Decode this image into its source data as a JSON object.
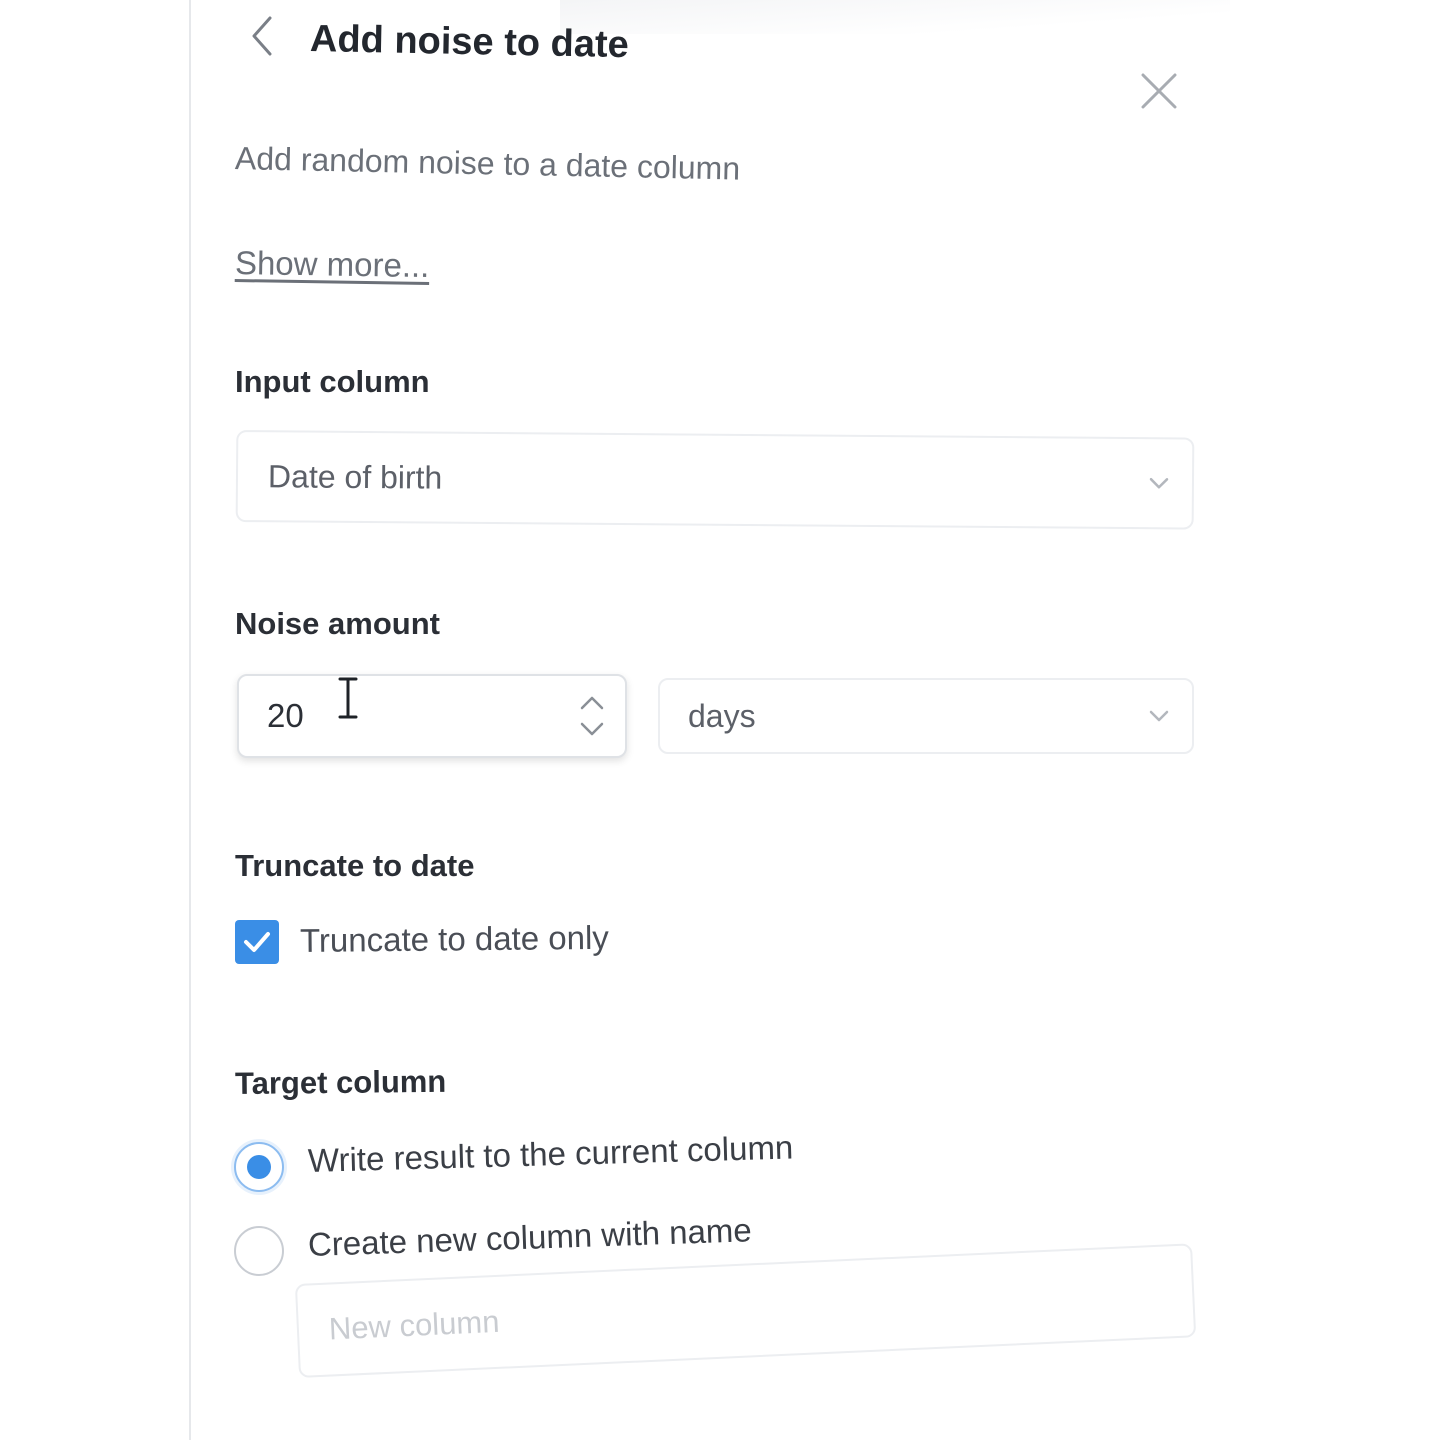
{
  "header": {
    "title": "Add noise to date",
    "subtitle": "Add random noise to a date column",
    "show_more": "Show more..."
  },
  "input_column": {
    "label": "Input column",
    "value": "Date of birth"
  },
  "noise_amount": {
    "label": "Noise amount",
    "value": "20",
    "unit": "days"
  },
  "truncate": {
    "label": "Truncate to date",
    "option_label": "Truncate to date only",
    "checked": true
  },
  "target_column": {
    "label": "Target column",
    "options": [
      {
        "label": "Write result to the current column",
        "selected": true
      },
      {
        "label": "Create new column with name",
        "selected": false
      }
    ],
    "new_column_placeholder": "New column"
  },
  "colors": {
    "accent": "#3a8ee6",
    "text": "#2b2f36",
    "muted": "#6b7078",
    "border": "#eceef1"
  },
  "icons": {
    "back": "chevron-left-icon",
    "close": "close-icon",
    "dropdown": "chevron-down-icon",
    "stepper": "up-down-chevron-icon",
    "checkbox": "checkmark-icon",
    "cursor": "text-cursor-icon"
  }
}
